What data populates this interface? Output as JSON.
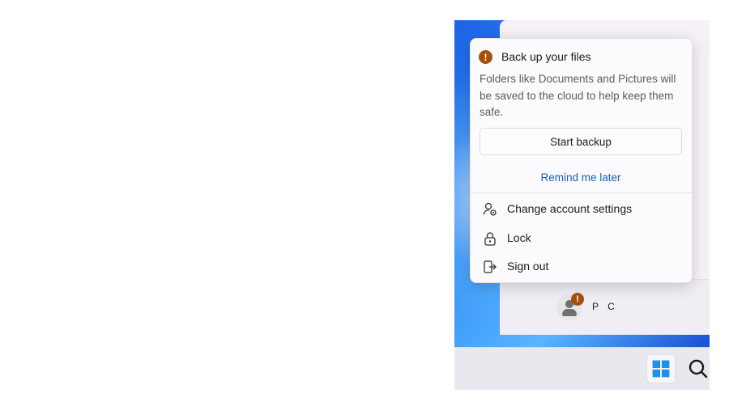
{
  "flyout": {
    "title": "Back up your files",
    "body": "Folders like Documents and Pictures will be saved to the cloud to help keep them safe.",
    "start_backup": "Start backup",
    "remind_later": "Remind me later",
    "menu": [
      {
        "label": "Change account settings",
        "icon": "account-settings-icon"
      },
      {
        "label": "Lock",
        "icon": "lock-icon"
      },
      {
        "label": "Sign out",
        "icon": "sign-out-icon"
      }
    ]
  },
  "user": {
    "name": "P C",
    "badge": "!"
  },
  "taskbar": {
    "start_icon": "windows-start-icon",
    "search_icon": "search-icon"
  },
  "colors": {
    "warning": "#a3520a",
    "link": "#1a5fb4",
    "windows_blue": "#1e90e8"
  }
}
